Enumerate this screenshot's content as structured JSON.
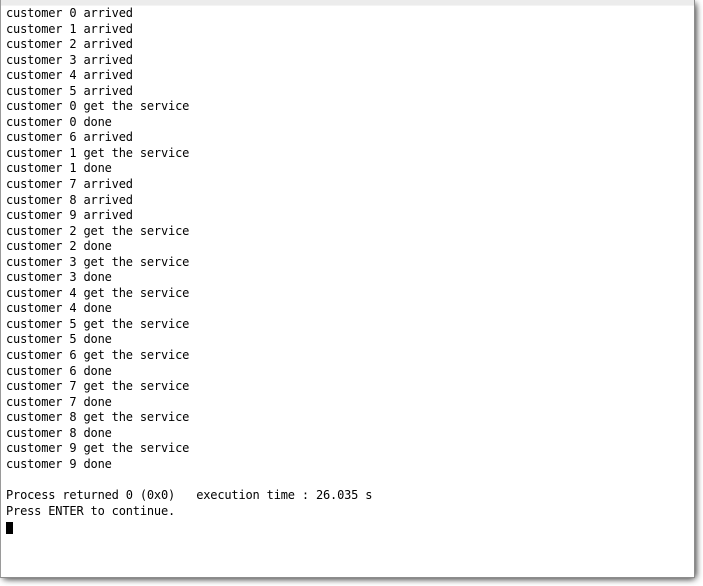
{
  "window": {
    "type": "console-window",
    "background_color": "#ffffff",
    "text_color": "#000000",
    "title_strip_color": "#ececec",
    "border_color": "#8d8d8d"
  },
  "console": {
    "lines": [
      "customer 0 arrived",
      "customer 1 arrived",
      "customer 2 arrived",
      "customer 3 arrived",
      "customer 4 arrived",
      "customer 5 arrived",
      "customer 0 get the service",
      "customer 0 done",
      "customer 6 arrived",
      "customer 1 get the service",
      "customer 1 done",
      "customer 7 arrived",
      "customer 8 arrived",
      "customer 9 arrived",
      "customer 2 get the service",
      "customer 2 done",
      "customer 3 get the service",
      "customer 3 done",
      "customer 4 get the service",
      "customer 4 done",
      "customer 5 get the service",
      "customer 5 done",
      "customer 6 get the service",
      "customer 6 done",
      "customer 7 get the service",
      "customer 7 done",
      "customer 8 get the service",
      "customer 8 done",
      "customer 9 get the service",
      "customer 9 done",
      "",
      "Process returned 0 (0x0)   execution time : 26.035 s",
      "Press ENTER to continue."
    ],
    "status": {
      "process_returned_label": "Process returned",
      "return_code": "0",
      "return_code_hex": "(0x0)",
      "execution_time_label": "execution time :",
      "execution_time_value": "26.035",
      "execution_time_unit": "s",
      "prompt": "Press ENTER to continue."
    },
    "cursor": {
      "visible": true,
      "style": "solid-block"
    }
  }
}
